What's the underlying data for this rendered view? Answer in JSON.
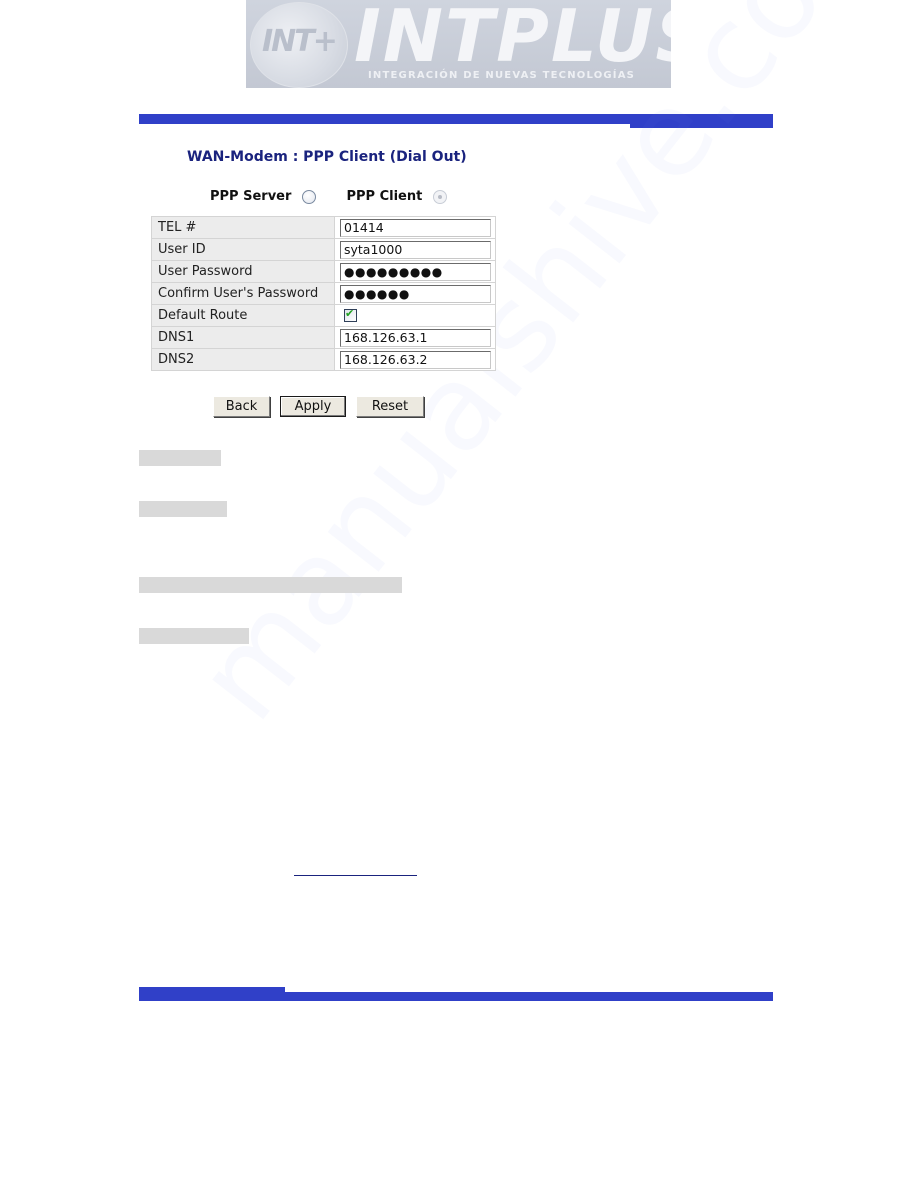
{
  "logo": {
    "mark": "INT+",
    "brand": "INTPLUS",
    "tagline": "INTEGRACIÓN DE NUEVAS TECNOLOGÍAS"
  },
  "page": {
    "title": "WAN-Modem : PPP Client (Dial Out)"
  },
  "mode": {
    "server_label": "PPP Server",
    "client_label": "PPP Client",
    "selected": "PPP Client"
  },
  "settings": {
    "rows": [
      {
        "label": "TEL #",
        "value": "01414"
      },
      {
        "label": "User ID",
        "value": "syta1000"
      },
      {
        "label": "User Password",
        "value": "●●●●●●●●●"
      },
      {
        "label": "Confirm User's Password",
        "value": "●●●●●●"
      },
      {
        "label": "Default Route",
        "checked": true
      },
      {
        "label": "DNS1",
        "value": "168.126.63.1"
      },
      {
        "label": "DNS2",
        "value": "168.126.63.2"
      }
    ]
  },
  "buttons": {
    "back": "Back",
    "apply": "Apply",
    "reset": "Reset"
  },
  "watermark": "manualshive.com",
  "colors": {
    "accent_bar": "#3040c8",
    "title": "#1a237e",
    "label_bg": "#ececec",
    "redacted_block": "#d9d9d9"
  }
}
